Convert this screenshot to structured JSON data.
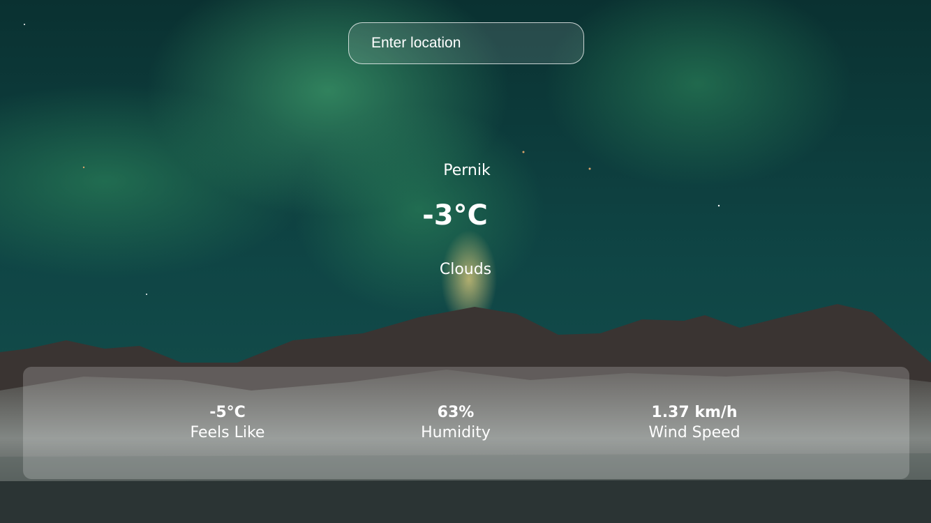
{
  "search": {
    "placeholder": "Enter location"
  },
  "weather": {
    "city": "Pernik",
    "temperature": "-3°C",
    "description": "Clouds"
  },
  "details": [
    {
      "value": "-5°C",
      "label": "Feels Like"
    },
    {
      "value": "63%",
      "label": "Humidity"
    },
    {
      "value": "1.37 km/h",
      "label": "Wind Speed"
    }
  ],
  "colors": {
    "sky_dark": "#0b3535",
    "aurora_green": "#2f8a5e",
    "mountain": "#3a3432",
    "snow": "#c9cfcb",
    "panel": "rgba(255,255,255,0.2)"
  },
  "background": "aurora-over-mountains-photo"
}
